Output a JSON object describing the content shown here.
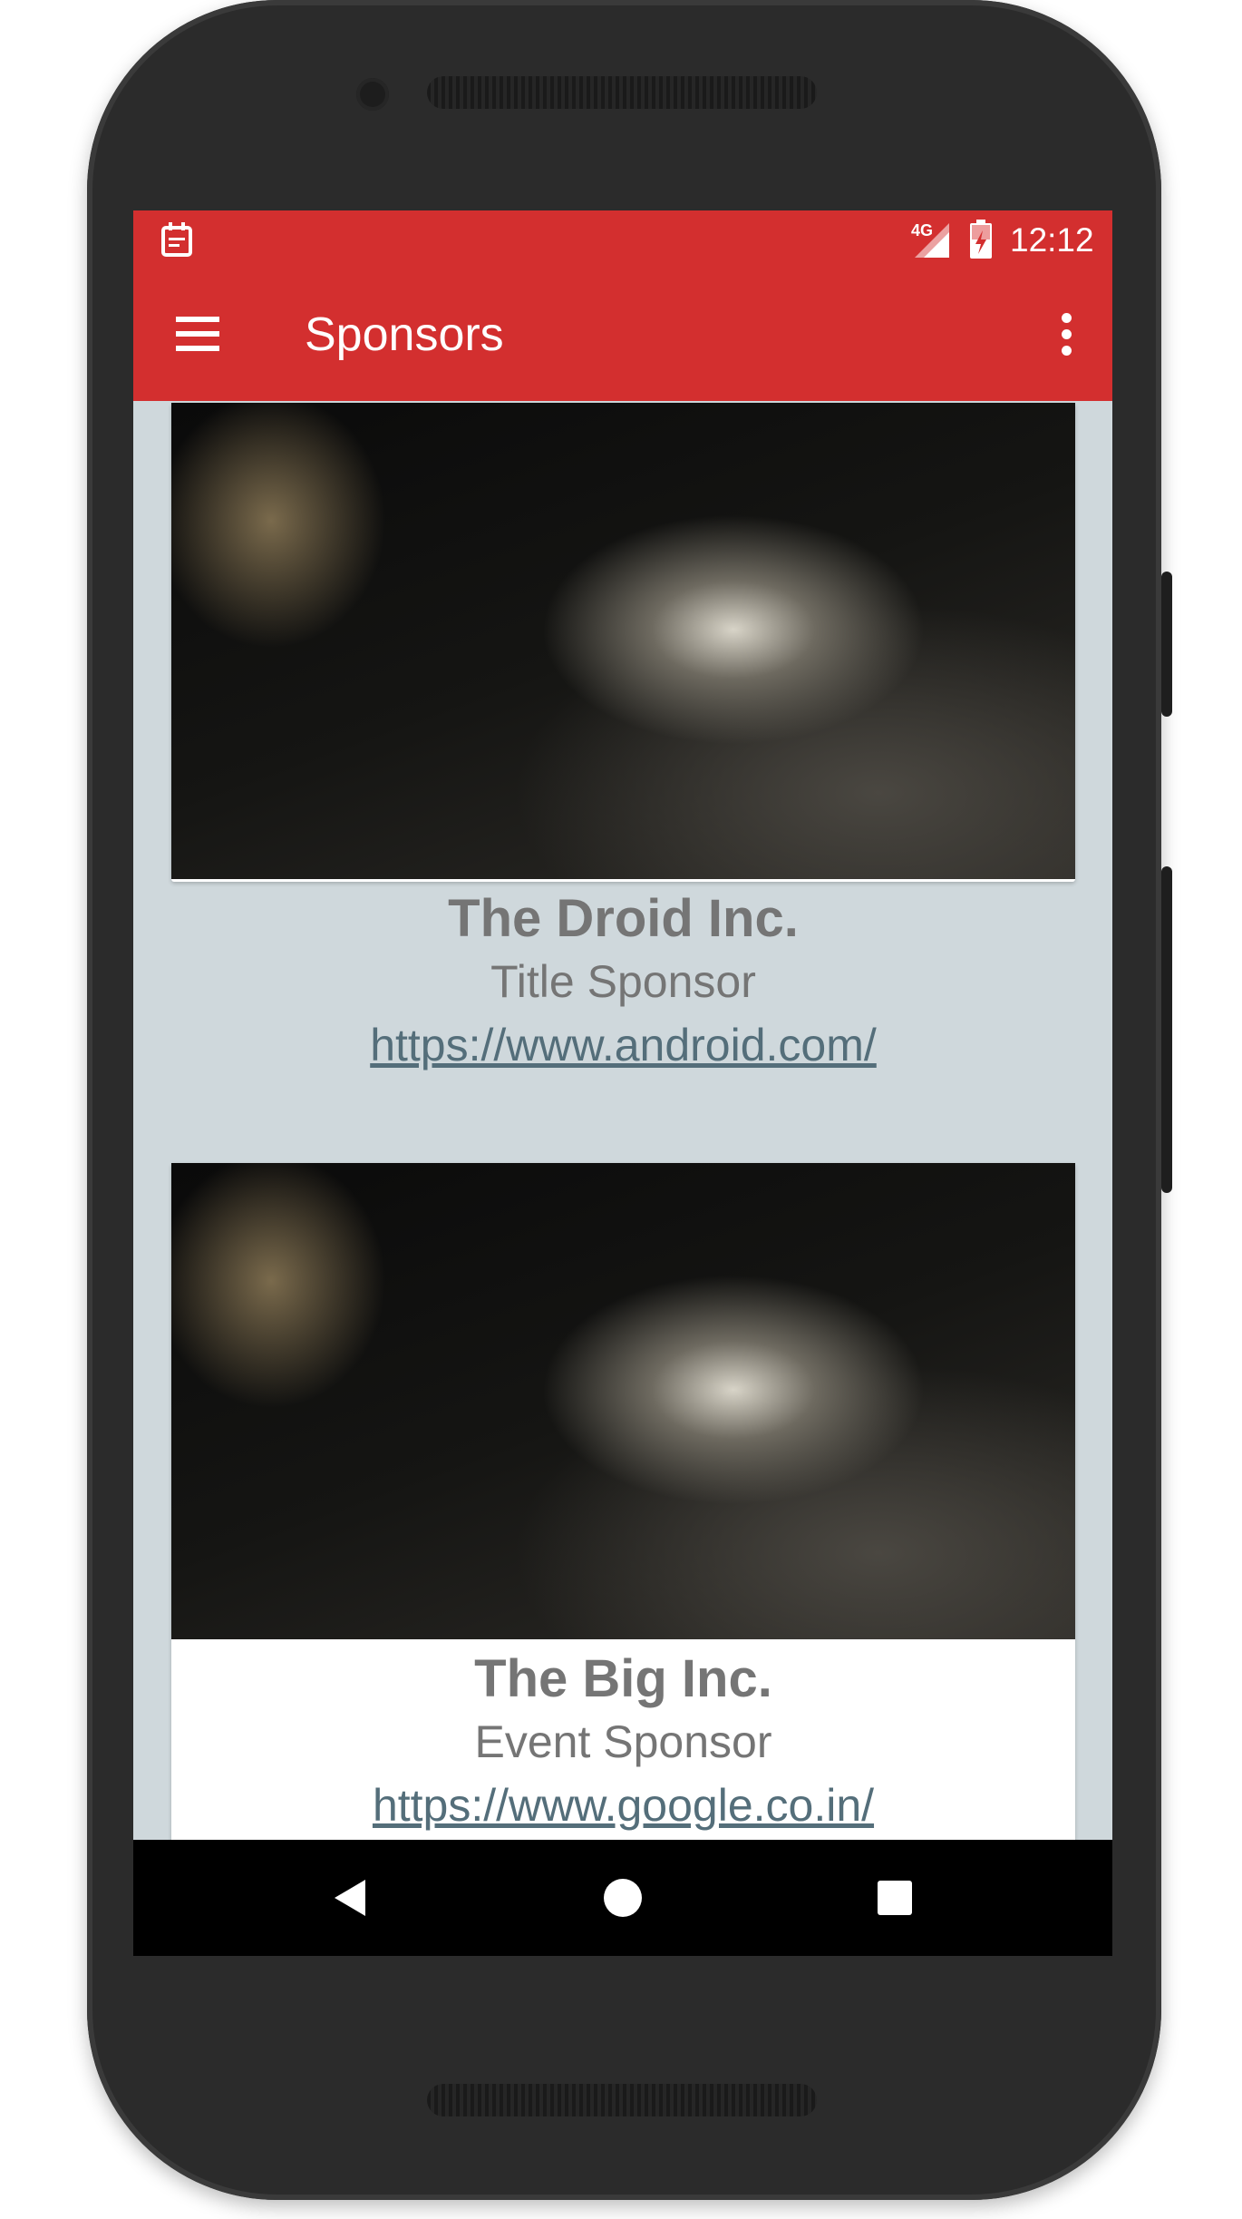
{
  "status_bar": {
    "time": "12:12",
    "network": "4G",
    "notification_icon": "calendar-icon",
    "signal_icon": "signal-icon",
    "battery_icon": "battery-charging-icon"
  },
  "toolbar": {
    "title": "Sponsors",
    "nav_icon": "hamburger-menu-icon",
    "overflow_icon": "more-vert-icon"
  },
  "sponsors": [
    {
      "name": "The Droid Inc.",
      "category": "Title Sponsor",
      "url": "https://www.android.com/"
    },
    {
      "name": "The Big Inc.",
      "category": "Event Sponsor",
      "url": "https://www.google.co.in/"
    }
  ],
  "nav_bar": {
    "back_icon": "back-icon",
    "home_icon": "home-icon",
    "recents_icon": "recents-icon"
  },
  "colors": {
    "primary": "#d32f2f",
    "background": "#cfd8dc",
    "text_secondary": "#757575",
    "link": "#546e7a"
  }
}
